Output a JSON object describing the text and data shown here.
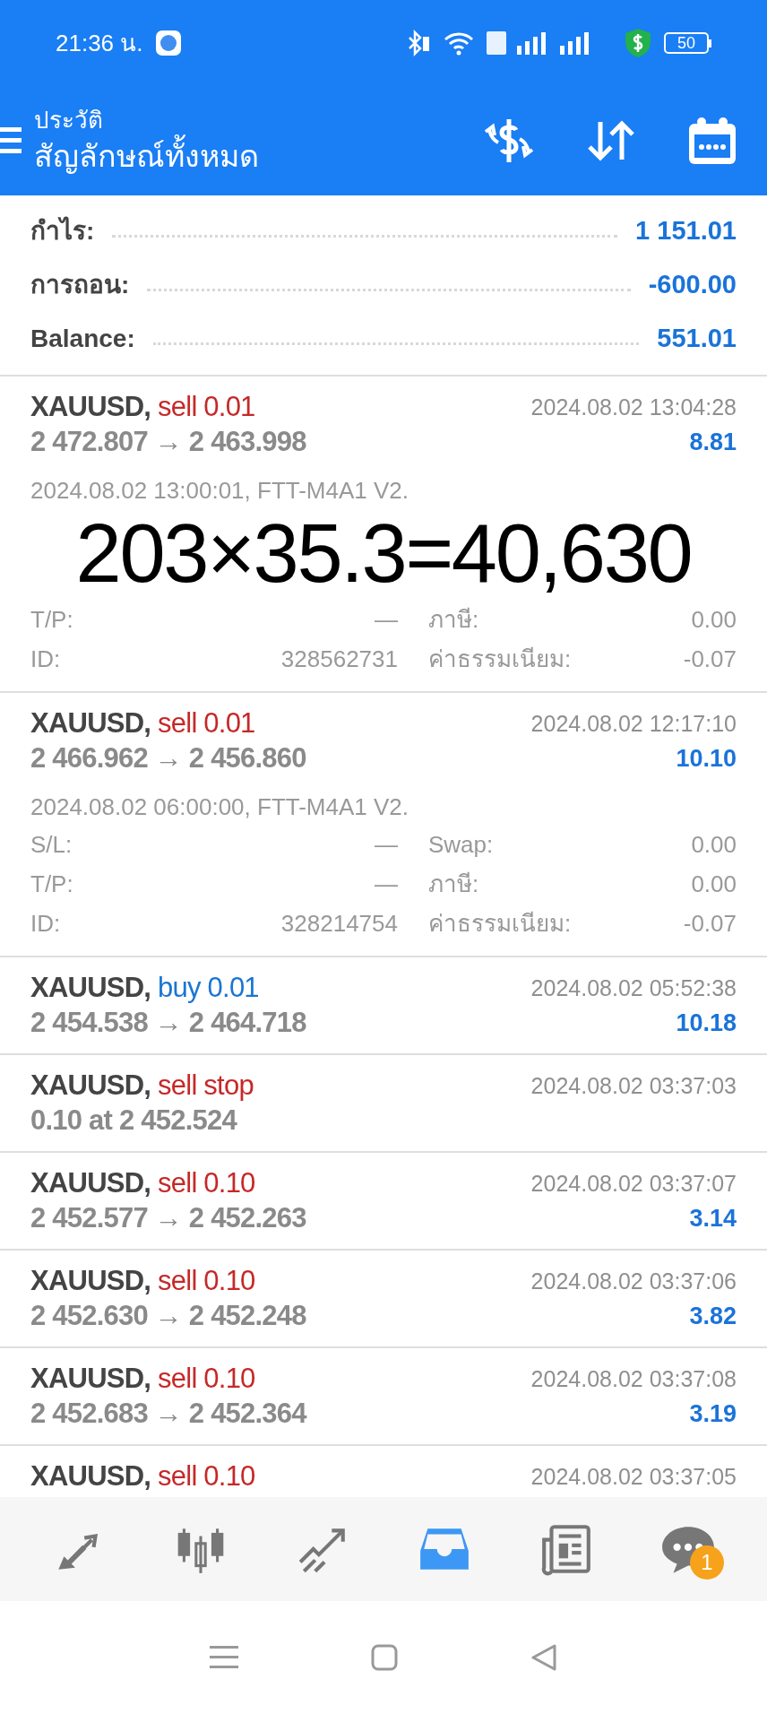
{
  "status_bar": {
    "time": "21:36 น.",
    "battery": "50"
  },
  "header": {
    "subtitle": "ประวัติ",
    "title": "สัญลักษณ์ทั้งหมด"
  },
  "summary": [
    {
      "label": "กำไร:",
      "value": "1 151.01"
    },
    {
      "label": "การถอน:",
      "value": "-600.00"
    },
    {
      "label": "Balance:",
      "value": "551.01"
    }
  ],
  "trades": [
    {
      "symbol": "XAUUSD,",
      "side": "sell 0.01",
      "kind": "sell",
      "prices": "2 472.807 → 2 463.998",
      "time": "2024.08.02 13:04:28",
      "profit": "8.81",
      "details": {
        "comment": "2024.08.02 13:00:01, FTT-M4A1 V2.",
        "rows": [
          {
            "kind": "overlay",
            "text": "203×35.3=40,630"
          },
          {
            "kind": "pair",
            "label1": "T/P:",
            "value1": "—",
            "label2": "ภาษี:",
            "value2": "0.00"
          },
          {
            "kind": "pair",
            "label1": "ID:",
            "value1": "328562731",
            "label2": "ค่าธรรมเนียม:",
            "value2": "-0.07"
          }
        ]
      }
    },
    {
      "symbol": "XAUUSD,",
      "side": "sell 0.01",
      "kind": "sell",
      "prices": "2 466.962 → 2 456.860",
      "time": "2024.08.02 12:17:10",
      "profit": "10.10",
      "details": {
        "comment": "2024.08.02 06:00:00, FTT-M4A1 V2.",
        "rows": [
          {
            "kind": "pair",
            "label1": "S/L:",
            "value1": "—",
            "label2": "Swap:",
            "value2": "0.00"
          },
          {
            "kind": "pair",
            "label1": "T/P:",
            "value1": "—",
            "label2": "ภาษี:",
            "value2": "0.00"
          },
          {
            "kind": "pair",
            "label1": "ID:",
            "value1": "328214754",
            "label2": "ค่าธรรมเนียม:",
            "value2": "-0.07"
          }
        ]
      }
    },
    {
      "symbol": "XAUUSD,",
      "side": "buy 0.01",
      "kind": "buy",
      "prices": "2 454.538 → 2 464.718",
      "time": "2024.08.02 05:52:38",
      "profit": "10.18"
    },
    {
      "symbol": "XAUUSD,",
      "side": "sell stop",
      "kind": "sell",
      "prices": "0.10 at 2 452.524",
      "time": "2024.08.02 03:37:03"
    },
    {
      "symbol": "XAUUSD,",
      "side": "sell 0.10",
      "kind": "sell",
      "prices": "2 452.577 → 2 452.263",
      "time": "2024.08.02 03:37:07",
      "profit": "3.14"
    },
    {
      "symbol": "XAUUSD,",
      "side": "sell 0.10",
      "kind": "sell",
      "prices": "2 452.630 → 2 452.248",
      "time": "2024.08.02 03:37:06",
      "profit": "3.82"
    },
    {
      "symbol": "XAUUSD,",
      "side": "sell 0.10",
      "kind": "sell",
      "prices": "2 452.683 → 2 452.364",
      "time": "2024.08.02 03:37:08",
      "profit": "3.19"
    },
    {
      "symbol": "XAUUSD,",
      "side": "sell 0.10",
      "kind": "sell",
      "time": "2024.08.02 03:37:05"
    }
  ],
  "bottom_nav": [
    {
      "kind": "trade",
      "selected": false
    },
    {
      "kind": "quotes",
      "selected": false
    },
    {
      "kind": "chart",
      "selected": false
    },
    {
      "kind": "history",
      "selected": true
    },
    {
      "kind": "news",
      "selected": false
    },
    {
      "kind": "chat",
      "selected": false,
      "badge": "1"
    }
  ]
}
